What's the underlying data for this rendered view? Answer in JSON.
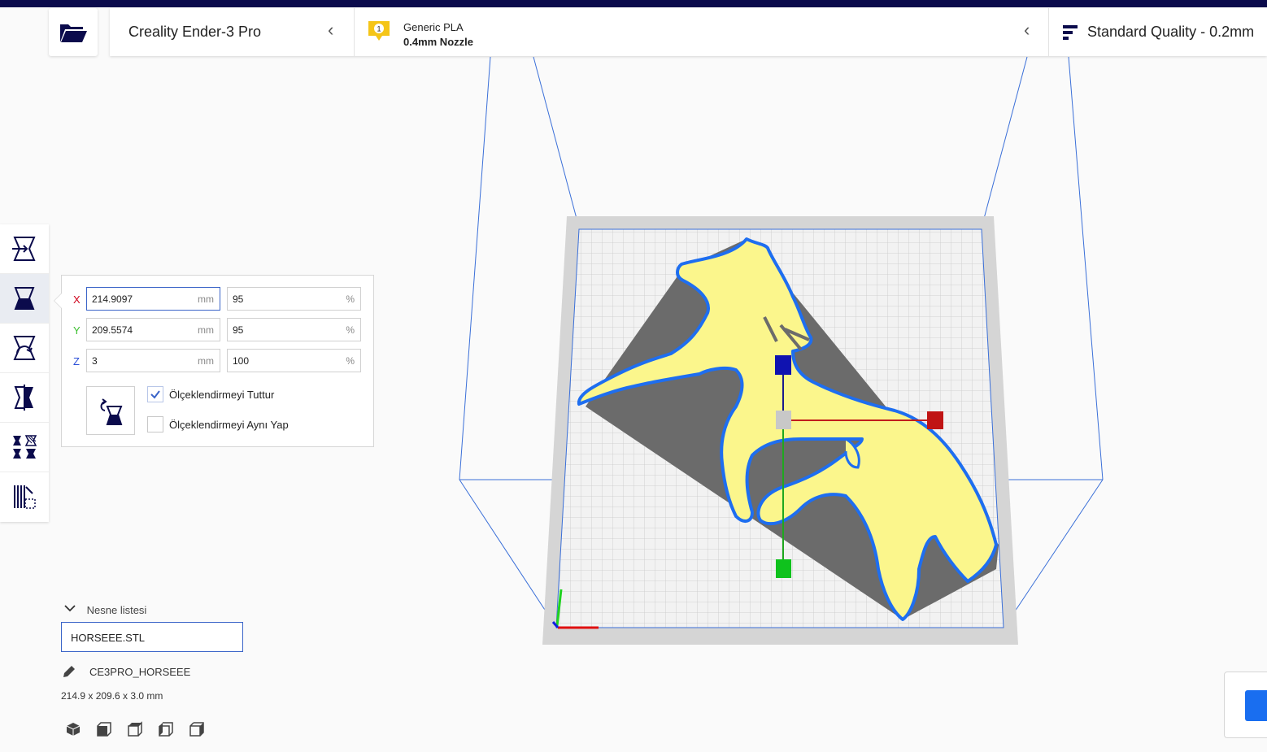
{
  "header": {
    "printer_name": "Creality Ender-3 Pro",
    "extruder_number": "1",
    "material": "Generic PLA",
    "nozzle": "0.4mm Nozzle",
    "quality": "Standard Quality - 0.2mm"
  },
  "toolbar": {
    "tools": [
      {
        "name": "move-tool",
        "icon": "move-icon"
      },
      {
        "name": "scale-tool",
        "icon": "scale-icon",
        "active": true
      },
      {
        "name": "rotate-tool",
        "icon": "rotate-icon"
      },
      {
        "name": "mirror-tool",
        "icon": "mirror-icon"
      },
      {
        "name": "per-model-settings-tool",
        "icon": "per-model-settings-icon"
      },
      {
        "name": "support-blocker-tool",
        "icon": "support-blocker-icon"
      }
    ]
  },
  "scale_panel": {
    "x": {
      "label": "X",
      "mm": "214.9097",
      "percent": "95",
      "color": "#d0021b"
    },
    "y": {
      "label": "Y",
      "mm": "209.5574",
      "percent": "95",
      "color": "#3bbf2f"
    },
    "z": {
      "label": "Z",
      "mm": "3",
      "percent": "100",
      "color": "#2b4fd8"
    },
    "unit_mm": "mm",
    "unit_percent": "%",
    "uniform_scaling_label": "Ölçeklendirmeyi Tuttur",
    "uniform_scaling_checked": true,
    "snap_scaling_label": "Ölçeklendirmeyi Aynı Yap",
    "snap_scaling_checked": false
  },
  "object_list": {
    "header": "Nesne listesi",
    "items": [
      "HORSEEE.STL"
    ],
    "job_name": "CE3PRO_HORSEEE",
    "dimensions": "214.9 x 209.6 x 3.0 mm"
  },
  "view_buttons": [
    "3d-view-icon",
    "front-view-icon",
    "top-view-icon",
    "left-view-icon",
    "right-view-icon"
  ],
  "colors": {
    "accent": "#196ef0",
    "brand_dark": "#0b0b4c",
    "model_yellow": "#fbf68c",
    "model_outline": "#1e6ef0",
    "shadow_gray": "#6b6b6b"
  }
}
